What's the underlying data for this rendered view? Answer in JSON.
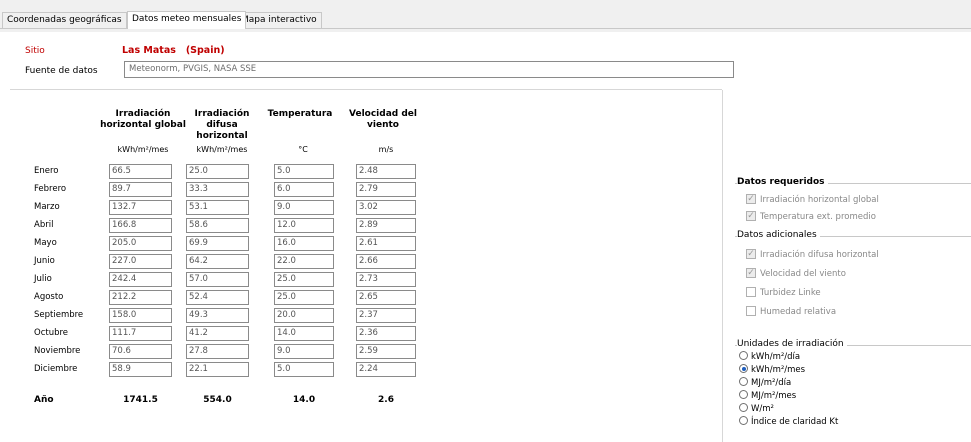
{
  "tabs": [
    {
      "label": "Coordenadas geográficas"
    },
    {
      "label": "Datos meteo mensuales"
    },
    {
      "label": "Mapa interactivo"
    }
  ],
  "site": {
    "label": "Sitio",
    "value": "Las Matas   (Spain)"
  },
  "data_source": {
    "label": "Fuente de datos",
    "value": "Meteonorm, PVGIS, NASA SSE"
  },
  "columns": [
    {
      "header": "Irradiación horizontal global",
      "unit": "kWh/m²/mes"
    },
    {
      "header": "Irradiación difusa horizontal",
      "unit": "kWh/m²/mes"
    },
    {
      "header": "Temperatura",
      "unit": "°C"
    },
    {
      "header": "Velocidad del viento",
      "unit": "m/s"
    }
  ],
  "rows": [
    {
      "month": "Enero",
      "values": [
        "66.5",
        "25.0",
        "5.0",
        "2.48"
      ]
    },
    {
      "month": "Febrero",
      "values": [
        "89.7",
        "33.3",
        "6.0",
        "2.79"
      ]
    },
    {
      "month": "Marzo",
      "values": [
        "132.7",
        "53.1",
        "9.0",
        "3.02"
      ]
    },
    {
      "month": "Abril",
      "values": [
        "166.8",
        "58.6",
        "12.0",
        "2.89"
      ]
    },
    {
      "month": "Mayo",
      "values": [
        "205.0",
        "69.9",
        "16.0",
        "2.61"
      ]
    },
    {
      "month": "Junio",
      "values": [
        "227.0",
        "64.2",
        "22.0",
        "2.66"
      ]
    },
    {
      "month": "Julio",
      "values": [
        "242.4",
        "57.0",
        "25.0",
        "2.73"
      ]
    },
    {
      "month": "Agosto",
      "values": [
        "212.2",
        "52.4",
        "25.0",
        "2.65"
      ]
    },
    {
      "month": "Septiembre",
      "values": [
        "158.0",
        "49.3",
        "20.0",
        "2.37"
      ]
    },
    {
      "month": "Octubre",
      "values": [
        "111.7",
        "41.2",
        "14.0",
        "2.36"
      ]
    },
    {
      "month": "Noviembre",
      "values": [
        "70.6",
        "27.8",
        "9.0",
        "2.59"
      ]
    },
    {
      "month": "Diciembre",
      "values": [
        "58.9",
        "22.1",
        "5.0",
        "2.24"
      ]
    }
  ],
  "year": {
    "label": "Año",
    "values": [
      "1741.5",
      "554.0",
      "14.0",
      "2.6"
    ]
  },
  "required": {
    "title": "Datos requeridos",
    "items": [
      {
        "label": "Irradiación horizontal global",
        "checked": true
      },
      {
        "label": "Temperatura ext. promedio",
        "checked": true
      }
    ]
  },
  "additional": {
    "title": "Datos adicionales",
    "items": [
      {
        "label": "Irradiación difusa horizontal",
        "checked": true
      },
      {
        "label": "Velocidad del viento",
        "checked": true
      },
      {
        "label": "Turbidez Linke",
        "checked": false
      },
      {
        "label": "Humedad relativa",
        "checked": false
      }
    ]
  },
  "units": {
    "title": "Unidades de irradiación",
    "options": [
      {
        "label": "kWh/m²/día",
        "selected": false
      },
      {
        "label": "kWh/m²/mes",
        "selected": true
      },
      {
        "label": "MJ/m²/día",
        "selected": false
      },
      {
        "label": "MJ/m²/mes",
        "selected": false
      },
      {
        "label": "W/m²",
        "selected": false
      },
      {
        "label": "Índice de claridad Kt",
        "selected": false
      }
    ]
  },
  "colors": {
    "site_text": "#c00000",
    "selected_radio": "#1f5fbf"
  }
}
